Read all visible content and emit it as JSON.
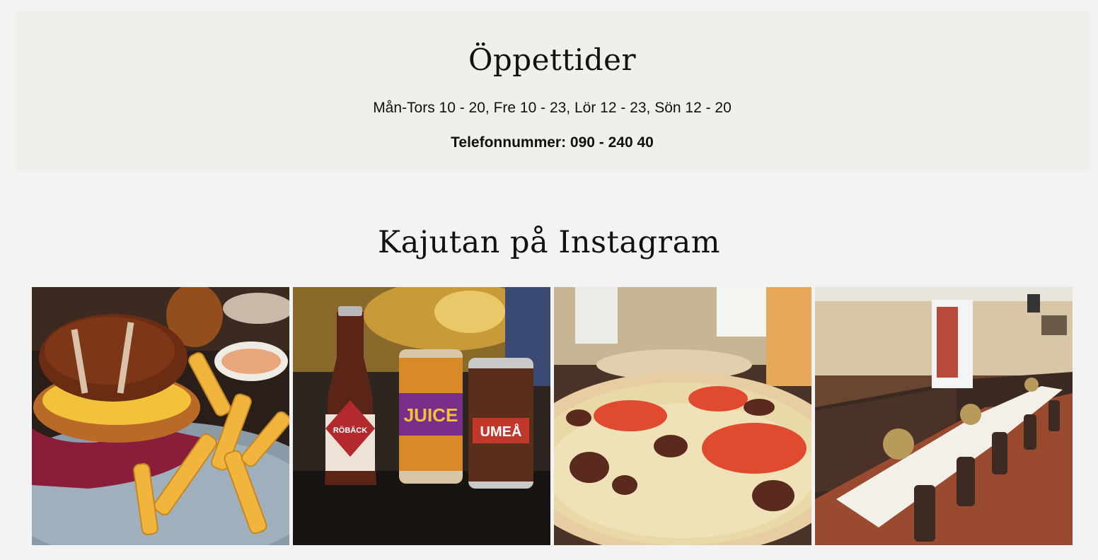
{
  "hours": {
    "title": "Öppettider",
    "schedule": "Mån-Tors 10 - 20, Fre 10 - 23, Lör 12 - 23, Sön 12 - 20",
    "phone": "Telefonnummer: 090 - 240 40"
  },
  "instagram": {
    "title": "Kajutan på Instagram",
    "posts": [
      {
        "subject": "pretzel burger with fries"
      },
      {
        "subject": "craft beer bottle and cans",
        "labels": [
          "RÖBÄCK",
          "JUICE",
          "UMEÅ"
        ]
      },
      {
        "subject": "pizza with tomato and meat"
      },
      {
        "subject": "dining room with set tables"
      }
    ]
  }
}
